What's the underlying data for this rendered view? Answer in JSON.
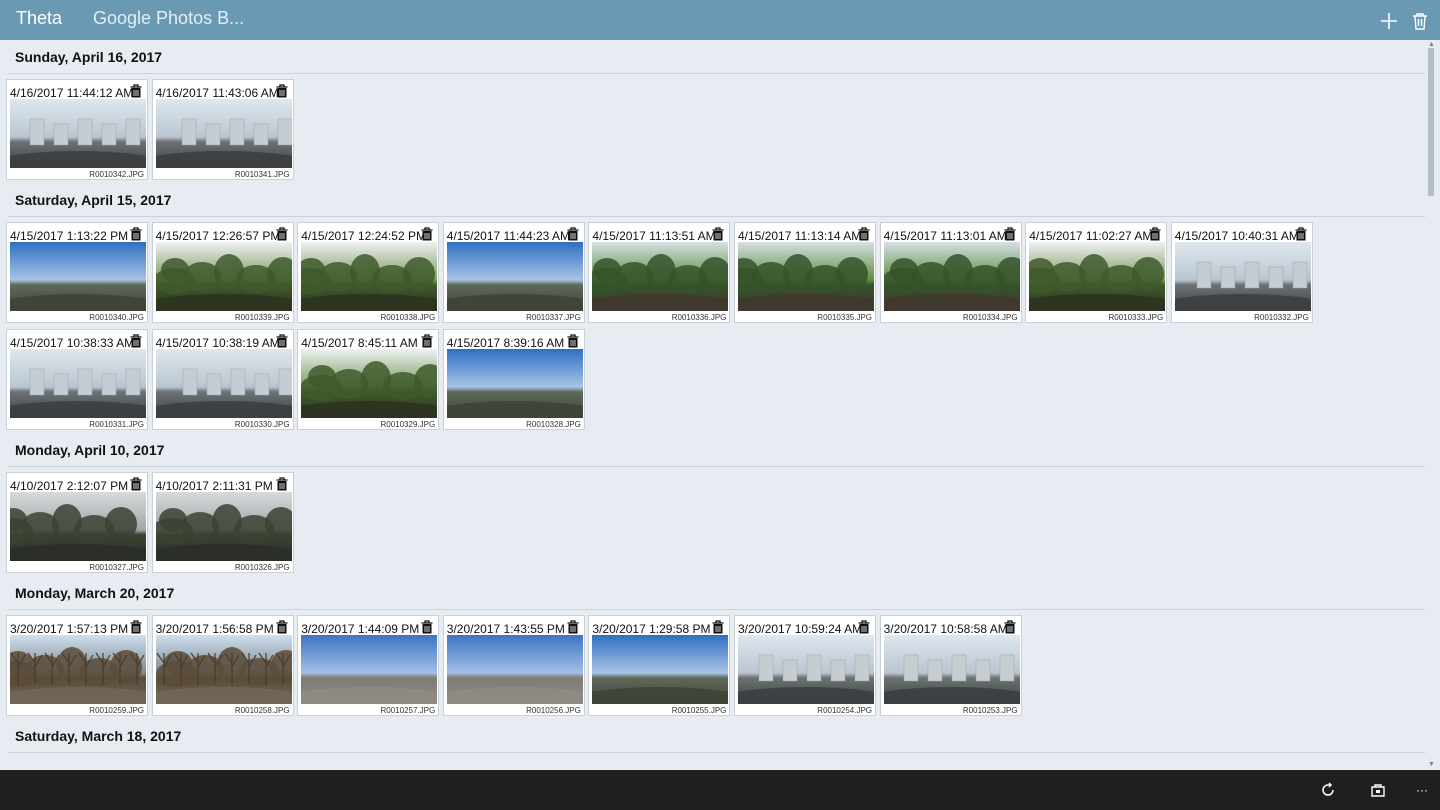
{
  "titlebar": {
    "tab_active": "Theta",
    "tab_other": "Google Photos B..."
  },
  "sections": [
    {
      "heading": "Sunday, April 16, 2017",
      "items": [
        {
          "timestamp": "4/16/2017 11:44:12 AM",
          "filename": "R0010342.JPG",
          "scene": "city"
        },
        {
          "timestamp": "4/16/2017 11:43:06 AM",
          "filename": "R0010341.JPG",
          "scene": "city"
        }
      ]
    },
    {
      "heading": "Saturday, April 15, 2017",
      "items": [
        {
          "timestamp": "4/15/2017 1:13:22 PM",
          "filename": "R0010340.JPG",
          "scene": "sky"
        },
        {
          "timestamp": "4/15/2017 12:26:57 PM",
          "filename": "R0010339.JPG",
          "scene": "forest"
        },
        {
          "timestamp": "4/15/2017 12:24:52 PM",
          "filename": "R0010338.JPG",
          "scene": "forest"
        },
        {
          "timestamp": "4/15/2017 11:44:23 AM",
          "filename": "R0010337.JPG",
          "scene": "sky"
        },
        {
          "timestamp": "4/15/2017 11:13:51 AM",
          "filename": "R0010336.JPG",
          "scene": "green"
        },
        {
          "timestamp": "4/15/2017 11:13:14 AM",
          "filename": "R0010335.JPG",
          "scene": "green"
        },
        {
          "timestamp": "4/15/2017 11:13:01 AM",
          "filename": "R0010334.JPG",
          "scene": "green"
        },
        {
          "timestamp": "4/15/2017 11:02:27 AM",
          "filename": "R0010333.JPG",
          "scene": "forest"
        },
        {
          "timestamp": "4/15/2017 10:40:31 AM",
          "filename": "R0010332.JPG",
          "scene": "city"
        },
        {
          "timestamp": "4/15/2017 10:38:33 AM",
          "filename": "R0010331.JPG",
          "scene": "city"
        },
        {
          "timestamp": "4/15/2017 10:38:19 AM",
          "filename": "R0010330.JPG",
          "scene": "city"
        },
        {
          "timestamp": "4/15/2017 8:45:11 AM",
          "filename": "R0010329.JPG",
          "scene": "forest"
        },
        {
          "timestamp": "4/15/2017 8:39:16 AM",
          "filename": "R0010328.JPG",
          "scene": "sky"
        }
      ]
    },
    {
      "heading": "Monday, April 10, 2017",
      "items": [
        {
          "timestamp": "4/10/2017 2:12:07 PM",
          "filename": "R0010327.JPG",
          "scene": "overcast"
        },
        {
          "timestamp": "4/10/2017 2:11:31 PM",
          "filename": "R0010326.JPG",
          "scene": "overcast"
        }
      ]
    },
    {
      "heading": "Monday, March 20, 2017",
      "items": [
        {
          "timestamp": "3/20/2017 1:57:13 PM",
          "filename": "R0010259.JPG",
          "scene": "trees"
        },
        {
          "timestamp": "3/20/2017 1:56:58 PM",
          "filename": "R0010258.JPG",
          "scene": "trees"
        },
        {
          "timestamp": "3/20/2017 1:44:09 PM",
          "filename": "R0010257.JPG",
          "scene": "plaza"
        },
        {
          "timestamp": "3/20/2017 1:43:55 PM",
          "filename": "R0010256.JPG",
          "scene": "plaza"
        },
        {
          "timestamp": "3/20/2017 1:29:58 PM",
          "filename": "R0010255.JPG",
          "scene": "sky"
        },
        {
          "timestamp": "3/20/2017 10:59:24 AM",
          "filename": "R0010254.JPG",
          "scene": "city"
        },
        {
          "timestamp": "3/20/2017 10:58:58 AM",
          "filename": "R0010253.JPG",
          "scene": "city"
        }
      ]
    },
    {
      "heading": "Saturday, March 18, 2017",
      "items": []
    }
  ],
  "colors": {
    "titlebar": "#6a9ab3",
    "content_bg": "#e6ecf1",
    "bottombar": "#1f1f1f"
  },
  "icons": {
    "add": "plus-icon",
    "delete": "trash-icon",
    "refresh": "refresh-icon",
    "store": "store-icon",
    "more": "more-icon"
  }
}
